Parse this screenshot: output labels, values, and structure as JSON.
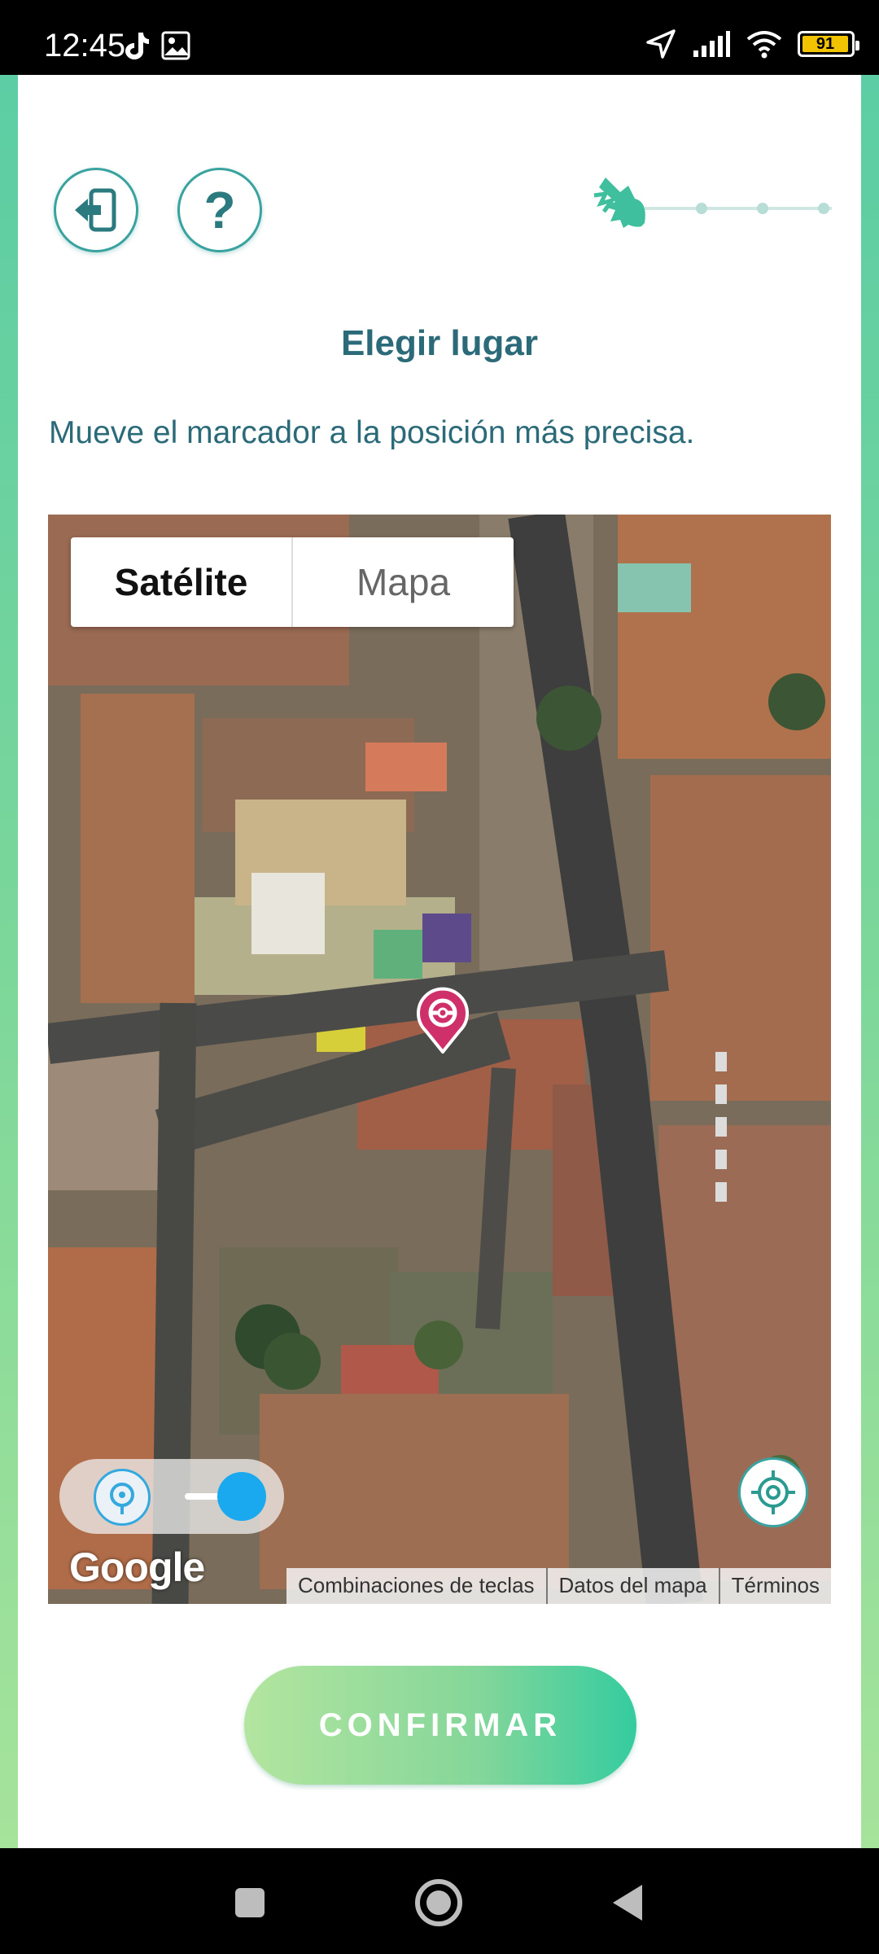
{
  "status_bar": {
    "time": "12:45",
    "battery_level": "91",
    "icons": [
      "tiktok-icon",
      "photo-icon",
      "location-arrow-icon",
      "signal-icon",
      "wifi-icon",
      "battery-icon"
    ]
  },
  "header": {
    "progress_steps": 4,
    "progress_current_step": 1
  },
  "page": {
    "title": "Elegir lugar",
    "instruction": "Mueve el marcador a la posición más precisa."
  },
  "map": {
    "toggle": {
      "satellite_label": "Satélite",
      "map_label": "Mapa",
      "selected": "Satélite"
    },
    "pokestop_toggle_on": true,
    "google_label": "Google",
    "attribution": {
      "shortcuts": "Combinaciones de teclas",
      "map_data": "Datos del mapa",
      "terms": "Términos"
    }
  },
  "actions": {
    "confirm_label": "CONFIRMAR"
  },
  "colors": {
    "accent_teal": "#2b6a78",
    "marker_pink": "#d0306a",
    "toggle_blue": "#1aa9ef",
    "battery_yellow": "#f2c300"
  }
}
